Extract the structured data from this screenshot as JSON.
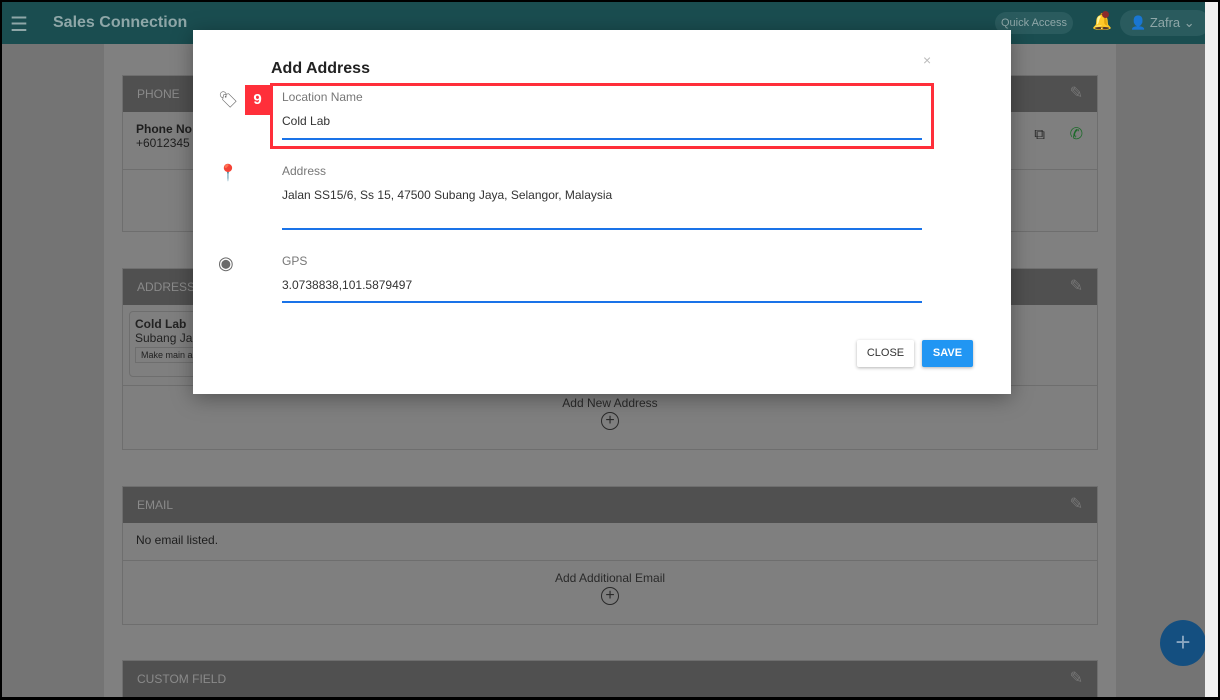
{
  "app": {
    "title": "Sales Connection",
    "quick_access": "Quick Access",
    "user": "Zafra"
  },
  "cards": {
    "phone": {
      "header": "PHONE",
      "label": "Phone No",
      "value": "+6012345"
    },
    "address": {
      "header": "ADDRESS",
      "name": "Cold Lab",
      "line": "Subang Ja",
      "make_main": "Make main a",
      "add": "Add New Address"
    },
    "email": {
      "header": "EMAIL",
      "empty": "No email listed.",
      "add": "Add Additional Email"
    },
    "custom": {
      "header": "CUSTOM FIELD"
    }
  },
  "modal": {
    "title": "Add Address",
    "annotation": "9",
    "location": {
      "label": "Location Name",
      "value": "Cold Lab"
    },
    "address": {
      "label": "Address",
      "value": "Jalan SS15/6, Ss 15, 47500 Subang Jaya, Selangor, Malaysia"
    },
    "gps": {
      "label": "GPS",
      "value": "3.0738838,101.5879497"
    },
    "close": "CLOSE",
    "save": "SAVE"
  },
  "colors": {
    "topbar": "#1a4d50",
    "save": "#2196f3",
    "highlight": "#ff2f3a",
    "input_line": "#1a73e8"
  }
}
